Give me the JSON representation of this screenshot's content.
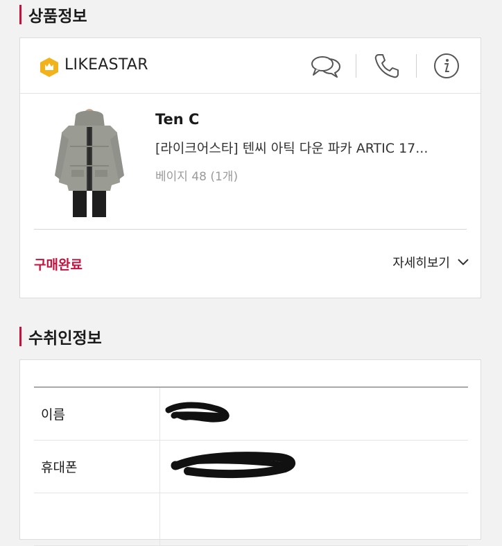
{
  "sections": {
    "product_info_title": "상품정보",
    "recipient_info_title": "수취인정보"
  },
  "seller": {
    "name": "LIKEASTAR",
    "icons": [
      "crown-badge-icon",
      "chat-icon",
      "phone-icon",
      "info-icon"
    ]
  },
  "product": {
    "brand": "Ten C",
    "title": "[라이크어스타] 텐씨 아틱 다운 파카 ARTIC 17...",
    "option": "베이지 48 (1개)",
    "image": "gray-down-parka-photo"
  },
  "order": {
    "status": "구매완료",
    "detail_label": "자세히보기"
  },
  "recipient": {
    "rows": [
      {
        "label": "이름",
        "value_state": "redacted"
      },
      {
        "label": "휴대폰",
        "value_state": "redacted"
      }
    ]
  },
  "colors": {
    "accent": "#c4123f",
    "badge": "#f2b21c",
    "background": "#f2f2f2"
  }
}
